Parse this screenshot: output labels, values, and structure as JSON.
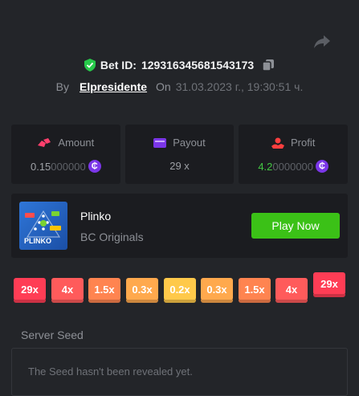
{
  "bet": {
    "id_label": "Bet ID:",
    "id_value": "129316345681543173",
    "by_label": "By",
    "username": "Elpresidente",
    "on_label": "On",
    "datetime": "31.03.2023 г., 19:30:51 ч."
  },
  "stats": [
    {
      "label": "Amount",
      "value_prefix": "0.15",
      "value_suffix": "000000",
      "icon": "coins-icon",
      "currency_icon": "bcd-coin-icon"
    },
    {
      "label": "Payout",
      "value": "29 x",
      "icon": "wallet-icon"
    },
    {
      "label": "Profit",
      "value_prefix": "4.2",
      "value_suffix": "0000000",
      "icon": "profit-icon",
      "currency_icon": "bcd-coin-icon"
    }
  ],
  "game": {
    "name": "Plinko",
    "provider": "BC Originals",
    "play_label": "Play Now",
    "thumb_text": "PLINKO"
  },
  "multipliers": [
    {
      "label": "29x",
      "color": "#ff3d55"
    },
    {
      "label": "4x",
      "color": "#ff5b5b"
    },
    {
      "label": "1.5x",
      "color": "#ff8450"
    },
    {
      "label": "0.3x",
      "color": "#ffa94d"
    },
    {
      "label": "0.2x",
      "color": "#ffc94a"
    },
    {
      "label": "0.3x",
      "color": "#ffa94d"
    },
    {
      "label": "1.5x",
      "color": "#ff8450"
    },
    {
      "label": "4x",
      "color": "#ff5b5b"
    },
    {
      "label": "29x",
      "color": "#ff3d55",
      "active": true
    }
  ],
  "seed": {
    "label": "Server Seed",
    "text": "The Seed hasn't been revealed yet."
  },
  "colors": {
    "background": "#232529",
    "card": "#1b1c20",
    "accent_green": "#3bc117",
    "coin_purple": "#7b36e8",
    "profit_green": "#43c743"
  }
}
